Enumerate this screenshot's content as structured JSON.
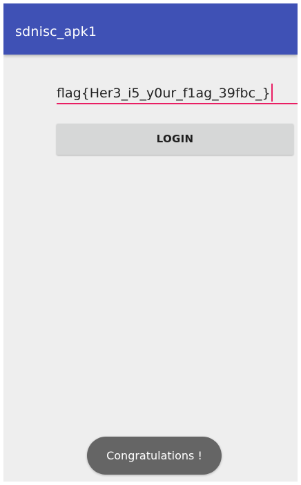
{
  "app_bar": {
    "title": "sdnisc_apk1",
    "background_color": "#3f51b5"
  },
  "form": {
    "input": {
      "value": "flag{Her3_i5_y0ur_f1ag_39fbc_}",
      "underline_color": "#e91e63"
    },
    "login_button": {
      "label": "LOGIN"
    }
  },
  "toast": {
    "message": "Congratulations !"
  }
}
